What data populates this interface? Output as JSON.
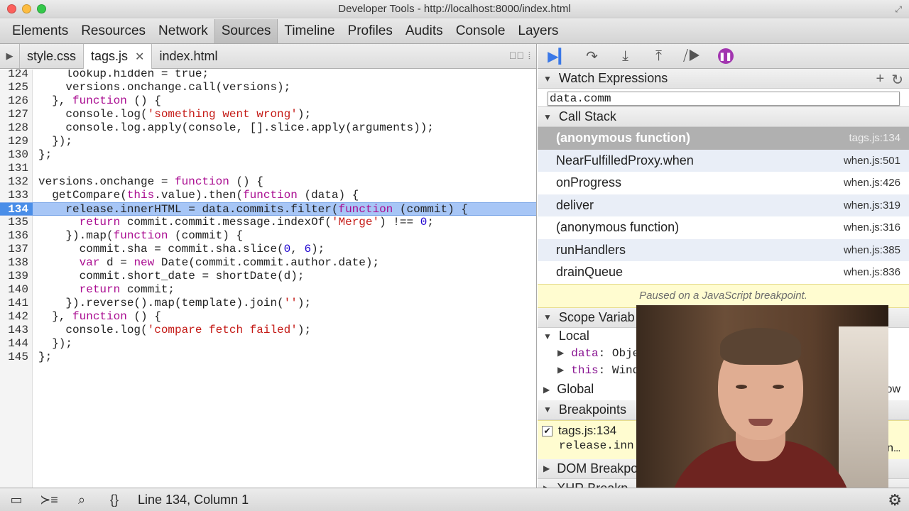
{
  "window": {
    "title": "Developer Tools - http://localhost:8000/index.html"
  },
  "panel_tabs": [
    "Elements",
    "Resources",
    "Network",
    "Sources",
    "Timeline",
    "Profiles",
    "Audits",
    "Console",
    "Layers"
  ],
  "active_panel": "Sources",
  "file_tabs": [
    {
      "label": "style.css"
    },
    {
      "label": "tags.js",
      "active": true
    },
    {
      "label": "index.html"
    }
  ],
  "code": {
    "highlight_line": "134",
    "lines": [
      {
        "n": "124",
        "text": "    lookup.hidden = true;"
      },
      {
        "n": "125",
        "text": "    versions.onchange.call(versions);"
      },
      {
        "n": "126",
        "text": "  }, function () {"
      },
      {
        "n": "127",
        "text": "    console.log('something went wrong');"
      },
      {
        "n": "128",
        "text": "    console.log.apply(console, [].slice.apply(arguments));"
      },
      {
        "n": "129",
        "text": "  });"
      },
      {
        "n": "130",
        "text": "};"
      },
      {
        "n": "131",
        "text": ""
      },
      {
        "n": "132",
        "text": "versions.onchange = function () {"
      },
      {
        "n": "133",
        "text": "  getCompare(this.value).then(function (data) {"
      },
      {
        "n": "134",
        "text": "    release.innerHTML = data.commits.filter(function (commit) {"
      },
      {
        "n": "135",
        "text": "      return commit.commit.message.indexOf('Merge') !== 0;"
      },
      {
        "n": "136",
        "text": "    }).map(function (commit) {"
      },
      {
        "n": "137",
        "text": "      commit.sha = commit.sha.slice(0, 6);"
      },
      {
        "n": "138",
        "text": "      var d = new Date(commit.commit.author.date);"
      },
      {
        "n": "139",
        "text": "      commit.short_date = shortDate(d);"
      },
      {
        "n": "140",
        "text": "      return commit;"
      },
      {
        "n": "141",
        "text": "    }).reverse().map(template).join('');"
      },
      {
        "n": "142",
        "text": "  }, function () {"
      },
      {
        "n": "143",
        "text": "    console.log('compare fetch failed');"
      },
      {
        "n": "144",
        "text": "  });"
      },
      {
        "n": "145",
        "text": "};"
      }
    ]
  },
  "watch": {
    "title": "Watch Expressions",
    "input_value": "data.comm"
  },
  "call_stack": {
    "title": "Call Stack",
    "frames": [
      {
        "fn": "(anonymous function)",
        "loc": "tags.js:134",
        "selected": true
      },
      {
        "fn": "NearFulfilledProxy.when",
        "loc": "when.js:501"
      },
      {
        "fn": "onProgress",
        "loc": "when.js:426"
      },
      {
        "fn": "deliver",
        "loc": "when.js:319"
      },
      {
        "fn": "(anonymous function)",
        "loc": "when.js:316"
      },
      {
        "fn": "runHandlers",
        "loc": "when.js:385"
      },
      {
        "fn": "drainQueue",
        "loc": "when.js:836"
      }
    ]
  },
  "paused_message": "Paused on a JavaScript breakpoint.",
  "scope": {
    "title": "Scope Variab",
    "local_label": "Local",
    "props": [
      {
        "name": "data",
        "value": "Obje"
      },
      {
        "name": "this",
        "value": "Wind"
      }
    ],
    "global_label": "Global",
    "global_value": "ow"
  },
  "breakpoints": {
    "title": "Breakpoints",
    "items": [
      {
        "label": "tags.js:134",
        "code": "release.inn",
        "code_tail": "on…"
      }
    ]
  },
  "dom_breakpoints": {
    "title": "DOM Breakpo"
  },
  "xhr_breakpoints": {
    "title": "XHR Breakp"
  },
  "status": {
    "position": "Line 134, Column 1"
  },
  "colors": {
    "highlight": "#a7c6f6",
    "accent": "#3a78e7",
    "pause": "#a235b0",
    "paused_bg": "#fffcd0"
  }
}
